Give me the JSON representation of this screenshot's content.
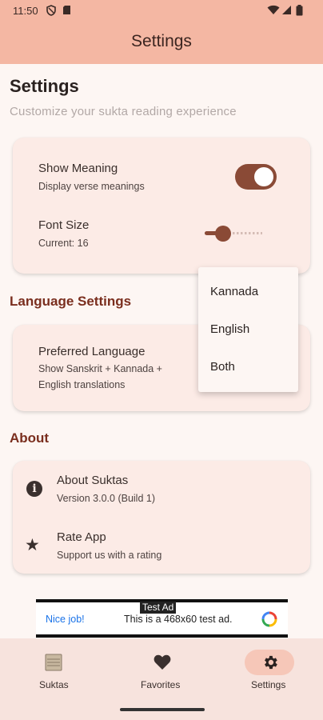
{
  "status_bar": {
    "time": "11:50"
  },
  "app_bar": {
    "title": "Settings"
  },
  "header": {
    "title": "Settings",
    "subtitle": "Customize your sukta reading experience"
  },
  "display": {
    "show_meaning": {
      "title": "Show Meaning",
      "subtitle": "Display verse meanings",
      "enabled": true
    },
    "font_size": {
      "title": "Font Size",
      "current_text": "Current: 16",
      "value": 16
    }
  },
  "language": {
    "section_title": "Language Settings",
    "preferred_title": "Preferred Language",
    "preferred_line1": "Show Sanskrit + Kannada +",
    "preferred_line2": "English translations",
    "options": [
      "Kannada",
      "English",
      "Both"
    ]
  },
  "about": {
    "section_title": "About",
    "about_title": "About Suktas",
    "about_sub": "Version 3.0.0 (Build 1)",
    "rate_title": "Rate App",
    "rate_sub": "Support us with a rating"
  },
  "ad": {
    "label": "Test Ad",
    "left_text": "Nice job!",
    "body_text": "This is a 468x60 test ad."
  },
  "bottom_nav": {
    "items": [
      {
        "label": "Suktas",
        "icon": "book-icon"
      },
      {
        "label": "Favorites",
        "icon": "heart-icon"
      },
      {
        "label": "Settings",
        "icon": "gear-icon",
        "selected": true
      }
    ]
  },
  "colors": {
    "app_bar": "#f4b7a3",
    "accent": "#8a4a36",
    "section_heading": "#7a2e1e",
    "card": "#fcebe6",
    "background": "#fdf6f3"
  }
}
